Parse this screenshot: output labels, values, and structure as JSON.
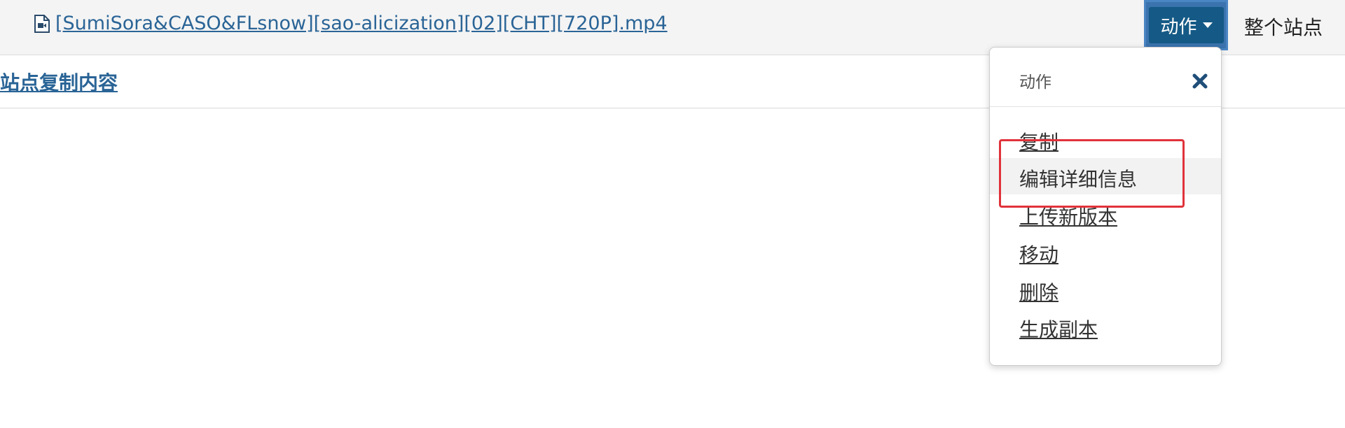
{
  "file": {
    "name": "[SumiSora&CASO&FLsnow][sao-alicization][02][CHT][720P].mp4",
    "icon": "video-file-icon"
  },
  "toolbar": {
    "action_button_label": "动作",
    "whole_site_label": "整个站点"
  },
  "subbar": {
    "copy_link_label": "站点复制内容"
  },
  "menu": {
    "title": "动作",
    "close_icon": "close-icon",
    "items": [
      {
        "label": "复制"
      },
      {
        "label": "编辑详细信息"
      },
      {
        "label": "上传新版本"
      },
      {
        "label": "移动"
      },
      {
        "label": "删除"
      },
      {
        "label": "生成副本"
      }
    ]
  },
  "colors": {
    "link": "#2a6496",
    "button_bg": "#155a86",
    "highlight_box": "#e0323a",
    "topbar_bg": "#f4f4f4"
  }
}
